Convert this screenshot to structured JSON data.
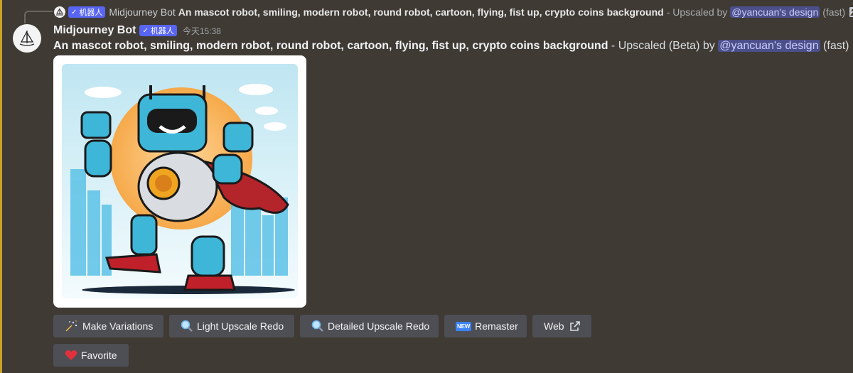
{
  "reply": {
    "bot_badge": "机器人",
    "author": "Midjourney Bot",
    "prompt": "An mascot robot, smiling, modern robot, round robot, cartoon, flying, fist up, crypto coins background",
    "suffix": "- Upscaled by",
    "mention": "@yancuan's design",
    "tail": "(fast)"
  },
  "message": {
    "author": "Midjourney Bot",
    "bot_badge": "机器人",
    "timestamp": "今天15:38",
    "prompt": "An mascot robot, smiling, modern robot, round robot, cartoon, flying, fist up, crypto coins background",
    "suffix": " - Upscaled (Beta) by ",
    "mention": "@yancuan's design",
    "tail": " (fast)"
  },
  "buttons": {
    "make_variations": "Make Variations",
    "light_upscale_redo": "Light Upscale Redo",
    "detailed_upscale_redo": "Detailed Upscale Redo",
    "remaster": "Remaster",
    "web": "Web",
    "favorite": "Favorite"
  },
  "icons": {
    "new_label": "NEW"
  },
  "colors": {
    "background": "#3f3a34",
    "button": "#4e4e55",
    "badge": "#5865f2",
    "mention": "#4b4f8a",
    "accent_rail": "#c9a227"
  }
}
